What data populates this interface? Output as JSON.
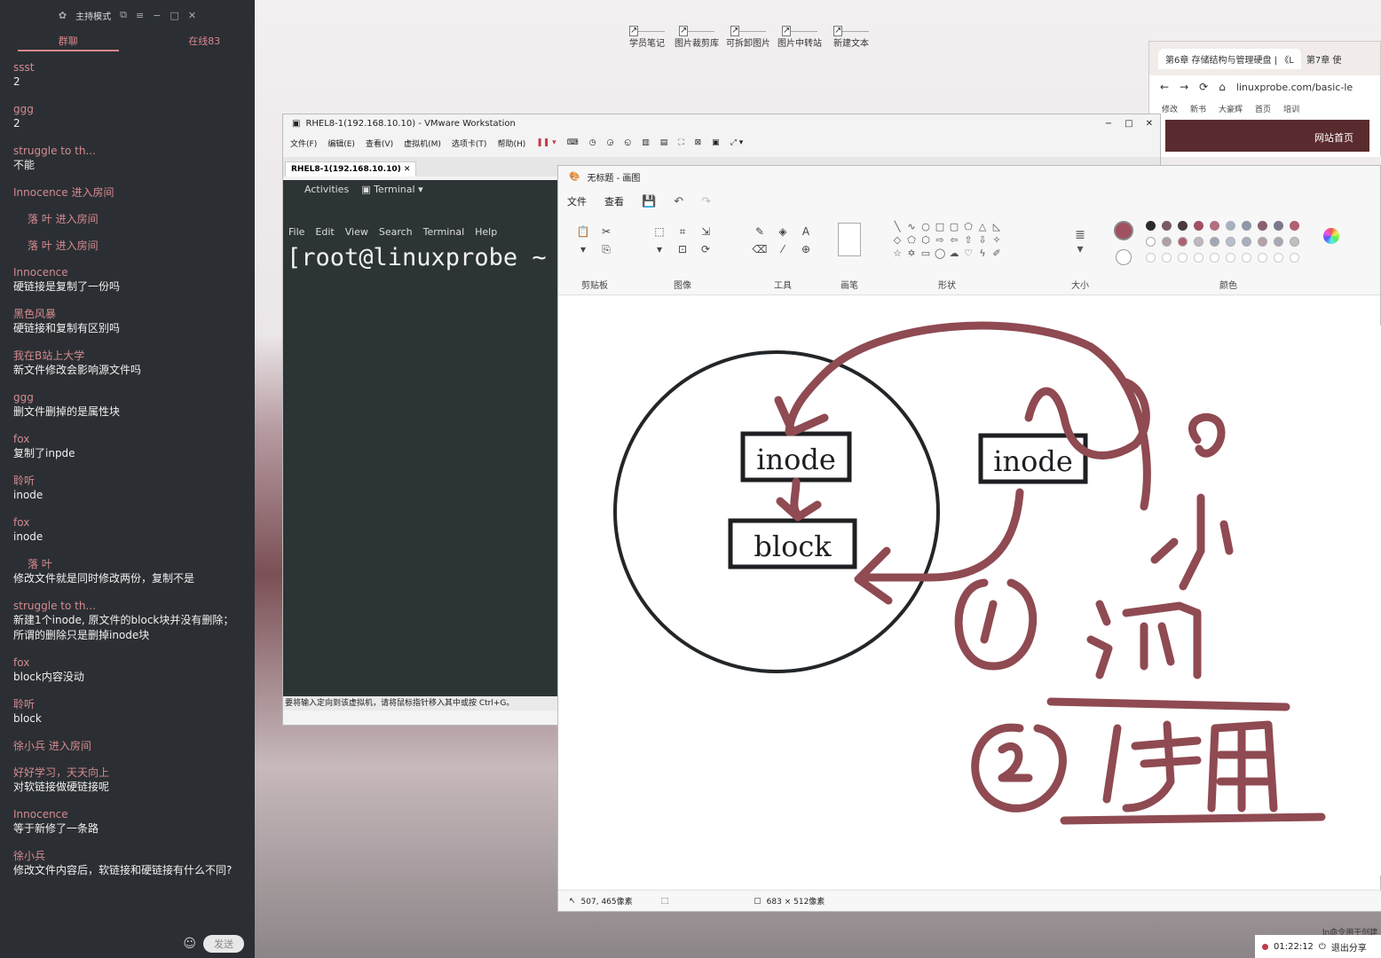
{
  "chat": {
    "header_title": "主持模式",
    "tabs": [
      "群聊",
      "在线83"
    ],
    "messages": [
      {
        "nick": "ssst",
        "text": "2"
      },
      {
        "nick": "ggg",
        "text": "2"
      },
      {
        "nick": "struggle to th...",
        "text": "不能"
      },
      {
        "nick": "Innocence 进入房间",
        "text": ""
      },
      {
        "nick": "落 叶 进入房间",
        "text": "",
        "indent": true
      },
      {
        "nick": "落 叶 进入房间",
        "text": "",
        "indent": true
      },
      {
        "nick": "Innocence",
        "text": "硬链接是复制了一份吗"
      },
      {
        "nick": "黑色风暴",
        "text": "硬链接和复制有区别吗"
      },
      {
        "nick": "我在B站上大学",
        "text": "新文件修改会影响源文件吗"
      },
      {
        "nick": "ggg",
        "text": "删文件删掉的是属性块"
      },
      {
        "nick": "fox",
        "text": "复制了inpde"
      },
      {
        "nick": "聆听",
        "text": "inode"
      },
      {
        "nick": "fox",
        "text": "inode"
      },
      {
        "nick": "落 叶",
        "text": "修改文件就是同时修改两份，复制不是",
        "indent": true
      },
      {
        "nick": "struggle to th...",
        "text": "新建1个inode, 原文件的block块并没有删除；所谓的删除只是删掉inode块"
      },
      {
        "nick": "fox",
        "text": "block内容没动"
      },
      {
        "nick": "聆听",
        "text": "block"
      },
      {
        "nick": "徐小兵 进入房间",
        "text": ""
      },
      {
        "nick": "好好学习，天天向上",
        "text": "对软链接做硬链接呢"
      },
      {
        "nick": "Innocence",
        "text": "等于新修了一条路"
      },
      {
        "nick": "徐小兵",
        "text": "修改文件内容后，软链接和硬链接有什么不同?"
      }
    ],
    "send_label": "发送"
  },
  "desktop": {
    "icons": [
      "学员笔记",
      "图片裁剪库",
      "可拆卸图片",
      "图片中转站",
      "新建文本"
    ]
  },
  "browser": {
    "tabs": [
      "第6章 存储结构与管理硬盘 | 《L",
      "第7章 使"
    ],
    "url": "linuxprobe.com/basic-le",
    "bookmarks": [
      "修改",
      "新书",
      "大豪辉",
      "首页",
      "培训"
    ],
    "site_button": "网站首页"
  },
  "vmware": {
    "title": "RHEL8-1(192.168.10.10) - VMware Workstation",
    "menu": [
      "文件(F)",
      "编辑(E)",
      "查看(V)",
      "虚拟机(M)",
      "选项卡(T)",
      "帮助(H)"
    ],
    "tab": "RHEL8-1(192.168.10.10)",
    "gnome": {
      "activities": "Activities",
      "terminal": "Terminal"
    },
    "term_menu": [
      "File",
      "Edit",
      "View",
      "Search",
      "Terminal",
      "Help"
    ],
    "prompt": "[root@linuxprobe ~",
    "status": "要将输入定向到该虚拟机，请将鼠标指针移入其中或按 Ctrl+G。"
  },
  "paint": {
    "title": "无标题 - 画图",
    "menu": [
      "文件",
      "查看"
    ],
    "groups": [
      "剪贴板",
      "图像",
      "工具",
      "画笔",
      "形状",
      "大小",
      "颜色"
    ],
    "canvas_text": {
      "inode_left": "inode",
      "block": "block",
      "inode_right": "inode"
    },
    "status": {
      "cursor": "507, 465像素",
      "size": "683 × 512像素"
    },
    "palette_row1": [
      "#2b2b2b",
      "#7a5a64",
      "#4a3a3e",
      "#a05060",
      "#b07080",
      "#a8b0c0",
      "#9098a8",
      "#8a6070",
      "#7a7a8a",
      "#b06070"
    ],
    "palette_row2": [
      "#ffffff",
      "#b0a0a8",
      "#b06070",
      "#c0b8c0",
      "#a0a8b8",
      "#b8c0d0",
      "#a8b0c0",
      "#b8a0a8",
      "#a8a8b8",
      "#c0c0c0"
    ],
    "ink_color": "#8f4a52"
  },
  "tray": {
    "time": "01:22:12",
    "exit_label": "退出分享",
    "note": "ln命令用于创建"
  }
}
